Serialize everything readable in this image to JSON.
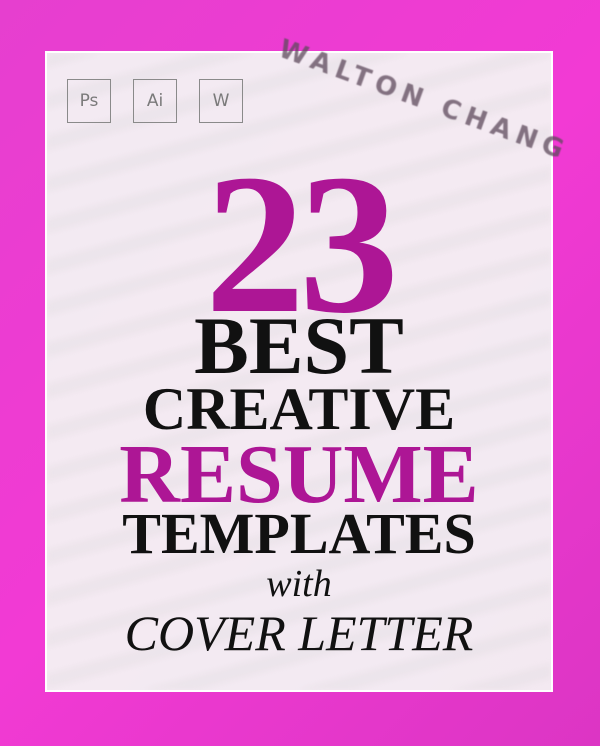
{
  "background_text": "WALTON CHANG",
  "software_badges": [
    "Ps",
    "Ai",
    "W"
  ],
  "title": {
    "number": "23",
    "line1": "BEST",
    "line2": "CREATIVE",
    "line3": "RESUME",
    "line4": "TEMPLATES",
    "line5": "with",
    "line6": "COVER LETTER"
  },
  "colors": {
    "background": "#e93bd0",
    "accent": "#ad1695",
    "text": "#111111"
  }
}
